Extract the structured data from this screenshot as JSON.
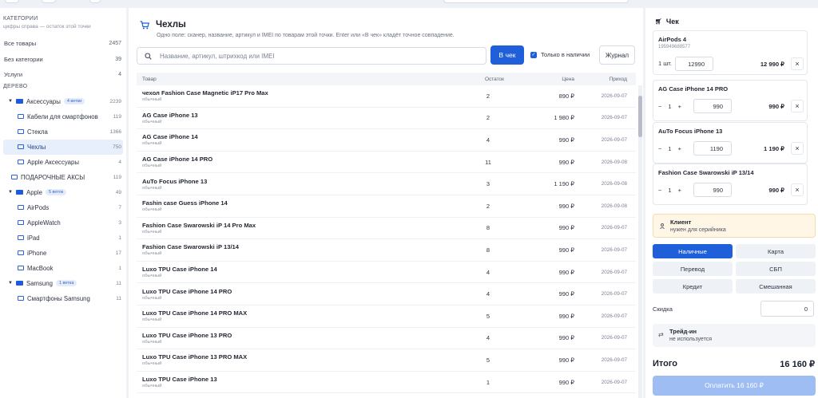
{
  "sidebar": {
    "categories_header": "КАТЕГОРИИ",
    "categories_hint": "цифры справа — остаток этой точки",
    "top_items": [
      {
        "label": "Все товары",
        "count": "2457"
      },
      {
        "label": "Без категории",
        "count": "39"
      },
      {
        "label": "Услуги",
        "count": "4"
      }
    ],
    "tree_header": "ДЕРЕВО",
    "tree": [
      {
        "label": "Аксессуары",
        "badge": "4 ветки",
        "count": "2239",
        "level": 0,
        "caret": "▼",
        "folder": "fill"
      },
      {
        "label": "Кабели для смартфонов",
        "badge": "",
        "count": "119",
        "level": 1,
        "caret": "",
        "folder": "out"
      },
      {
        "label": "Стекла",
        "badge": "",
        "count": "1366",
        "level": 1,
        "caret": "",
        "folder": "out"
      },
      {
        "label": "Чехлы",
        "badge": "",
        "count": "750",
        "level": 1,
        "caret": "",
        "folder": "out",
        "active": true
      },
      {
        "label": "Apple Аксессуары",
        "badge": "",
        "count": "4",
        "level": 1,
        "caret": "",
        "folder": "out"
      },
      {
        "label": "ПОДАРОЧНЫЕ АКСЫ",
        "badge": "",
        "count": "119",
        "level": 0,
        "caret": "",
        "folder": "out"
      },
      {
        "label": "Apple",
        "badge": "5 веток",
        "count": "49",
        "level": 0,
        "caret": "▼",
        "folder": "fill"
      },
      {
        "label": "AirPods",
        "badge": "",
        "count": "7",
        "level": 1,
        "caret": "",
        "folder": "out"
      },
      {
        "label": "AppleWatch",
        "badge": "",
        "count": "3",
        "level": 1,
        "caret": "",
        "folder": "out"
      },
      {
        "label": "iPad",
        "badge": "",
        "count": "1",
        "level": 1,
        "caret": "",
        "folder": "out"
      },
      {
        "label": "iPhone",
        "badge": "",
        "count": "17",
        "level": 1,
        "caret": "",
        "folder": "out"
      },
      {
        "label": "MacBook",
        "badge": "",
        "count": "1",
        "level": 1,
        "caret": "",
        "folder": "out"
      },
      {
        "label": "Samsung",
        "badge": "1 ветка",
        "count": "11",
        "level": 0,
        "caret": "▼",
        "folder": "fill"
      },
      {
        "label": "Смартфоны Samsung",
        "badge": "",
        "count": "11",
        "level": 1,
        "caret": "",
        "folder": "out"
      }
    ]
  },
  "main": {
    "title": "Чехлы",
    "subtitle": "Одно поле: сканер, название, артикул и IMEI по товарам этой точки. Enter или «В чек» кладёт точное совпадение.",
    "search_placeholder": "Название, артикул, штрихкод или IMEI",
    "add_to_check_label": "В чек",
    "in_stock_label": "Только в наличии",
    "journal_label": "Журнал",
    "columns": {
      "name": "Товар",
      "stock": "Остаток",
      "price": "Цена",
      "arrival": "Приход"
    },
    "rows": [
      {
        "name": "чехол Fashion Case Magnetic iP17 Pro Max",
        "type": "обычный",
        "stock": "2",
        "price": "890 ₽",
        "date": "2026-09-07"
      },
      {
        "name": "AG Case iPhone 13",
        "type": "обычный",
        "stock": "2",
        "price": "1 980 ₽",
        "date": "2026-09-07"
      },
      {
        "name": "AG Case iPhone 14",
        "type": "обычный",
        "stock": "4",
        "price": "990 ₽",
        "date": "2026-09-07"
      },
      {
        "name": "AG Case iPhone 14 PRO",
        "type": "обычный",
        "stock": "11",
        "price": "990 ₽",
        "date": "2026-09-08"
      },
      {
        "name": "AuTo Focus iPhone 13",
        "type": "обычный",
        "stock": "3",
        "price": "1 190 ₽",
        "date": "2026-09-08"
      },
      {
        "name": "Fashin case Guess iPhone 14",
        "type": "обычный",
        "stock": "2",
        "price": "990 ₽",
        "date": "2026-09-08"
      },
      {
        "name": "Fashion Case Swarowski iP 14 Pro Max",
        "type": "обычный",
        "stock": "8",
        "price": "990 ₽",
        "date": "2026-09-07"
      },
      {
        "name": "Fashion Case Swarowski iP 13/14",
        "type": "обычный",
        "stock": "8",
        "price": "990 ₽",
        "date": "2026-09-07"
      },
      {
        "name": "Luxo TPU Case iPhone 14",
        "type": "обычный",
        "stock": "4",
        "price": "990 ₽",
        "date": "2026-09-07"
      },
      {
        "name": "Luxo TPU Case iPhone 14 PRO",
        "type": "обычный",
        "stock": "4",
        "price": "990 ₽",
        "date": "2026-09-07"
      },
      {
        "name": "Luxo TPU Case iPhone 14 PRO MAX",
        "type": "обычный",
        "stock": "5",
        "price": "990 ₽",
        "date": "2026-09-07"
      },
      {
        "name": "Luxo TPU Case iPhone 13 PRO",
        "type": "обычный",
        "stock": "4",
        "price": "990 ₽",
        "date": "2026-09-07"
      },
      {
        "name": "Luxo TPU Case iPhone 13 PRO MAX",
        "type": "обычный",
        "stock": "5",
        "price": "990 ₽",
        "date": "2026-09-07"
      },
      {
        "name": "Luxo TPU Case iPhone 13",
        "type": "обычный",
        "stock": "1",
        "price": "990 ₽",
        "date": "2026-09-07"
      }
    ]
  },
  "receipt": {
    "title": "Чек",
    "items": [
      {
        "name": "AirPods 4",
        "serial": "195949688577",
        "qty_label": "1 шт.",
        "qty": "",
        "price_field": "12990",
        "sum": "12 990 ₽"
      },
      {
        "name": "AG Case iPhone 14 PRO",
        "serial": "",
        "qty_label": "",
        "qty": "1",
        "price_field": "990",
        "sum": "990 ₽"
      },
      {
        "name": "AuTo Focus iPhone 13",
        "serial": "",
        "qty_label": "",
        "qty": "1",
        "price_field": "1190",
        "sum": "1 190 ₽"
      },
      {
        "name": "Fashion Case Swarowski iP 13/14",
        "serial": "",
        "qty_label": "",
        "qty": "1",
        "price_field": "990",
        "sum": "990 ₽"
      }
    ],
    "client_title": "Клиент",
    "client_note": "нужен для серийника",
    "payment_methods": [
      "Наличные",
      "Карта",
      "Перевод",
      "СБП",
      "Кредит",
      "Смешанная"
    ],
    "discount_label": "Скидка",
    "discount_value": "0",
    "tradein_title": "Трейд-ин",
    "tradein_note": "не используется",
    "total_label": "Итого",
    "total_value": "16 160 ₽",
    "pay_button": "Оплатить 16 160 ₽"
  },
  "colors": {
    "accent": "#1f5fd9",
    "active_bg": "#e7effc",
    "client_bg": "#fff6e6",
    "pay_disabled": "#9ebdf3"
  },
  "icons": {
    "cart": "cart-icon",
    "search": "search-icon",
    "folder": "folder-icon",
    "close": "close-icon",
    "user": "user-icon",
    "swap": "swap-icon"
  }
}
